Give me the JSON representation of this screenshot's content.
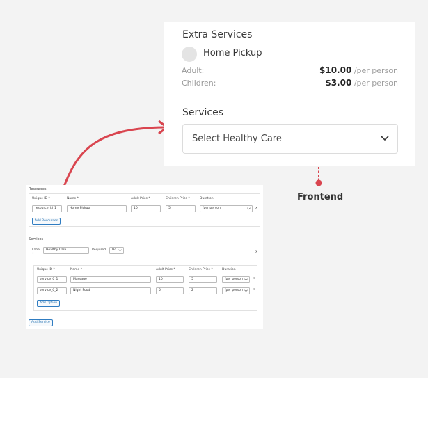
{
  "frontend": {
    "extra_title": "Extra Services",
    "option": "Home Pickup",
    "adult_label": "Adult:",
    "adult_price": "$10.00",
    "adult_unit": "/per person",
    "children_label": "Children:",
    "children_price": "$3.00",
    "children_unit": "/per person",
    "services_title": "Services",
    "select_value": "Select Healthy Care"
  },
  "frontend_label": "Frontend",
  "backend": {
    "resources_title": "Resources",
    "columns": {
      "unique_id": "Unique ID *",
      "name": "Name *",
      "adult_price": "Adult Price *",
      "children_price": "Children Price *",
      "duration": "Duration"
    },
    "resource_row": {
      "id": "resource_id_1",
      "name": "Home Pickup",
      "adult": "10",
      "children": "5",
      "duration": "/per person"
    },
    "add_resources": "Add Resources",
    "services_title": "Services",
    "label_text": "Label",
    "label_value": "Healthy Care",
    "required_text": "Required",
    "required_value": "No",
    "service_rows": [
      {
        "id": "service_0_1",
        "name": "Massage",
        "adult": "10",
        "children": "5",
        "duration": "/per person"
      },
      {
        "id": "service_0_2",
        "name": "Night Food",
        "adult": "5",
        "children": "2",
        "duration": "/per person"
      }
    ],
    "add_option": "Add Option",
    "add_service": "Add Service",
    "remove_mark": "x",
    "required_mark": "*"
  },
  "colors": {
    "accent_red": "#d9454f",
    "admin_blue": "#2271b1"
  }
}
